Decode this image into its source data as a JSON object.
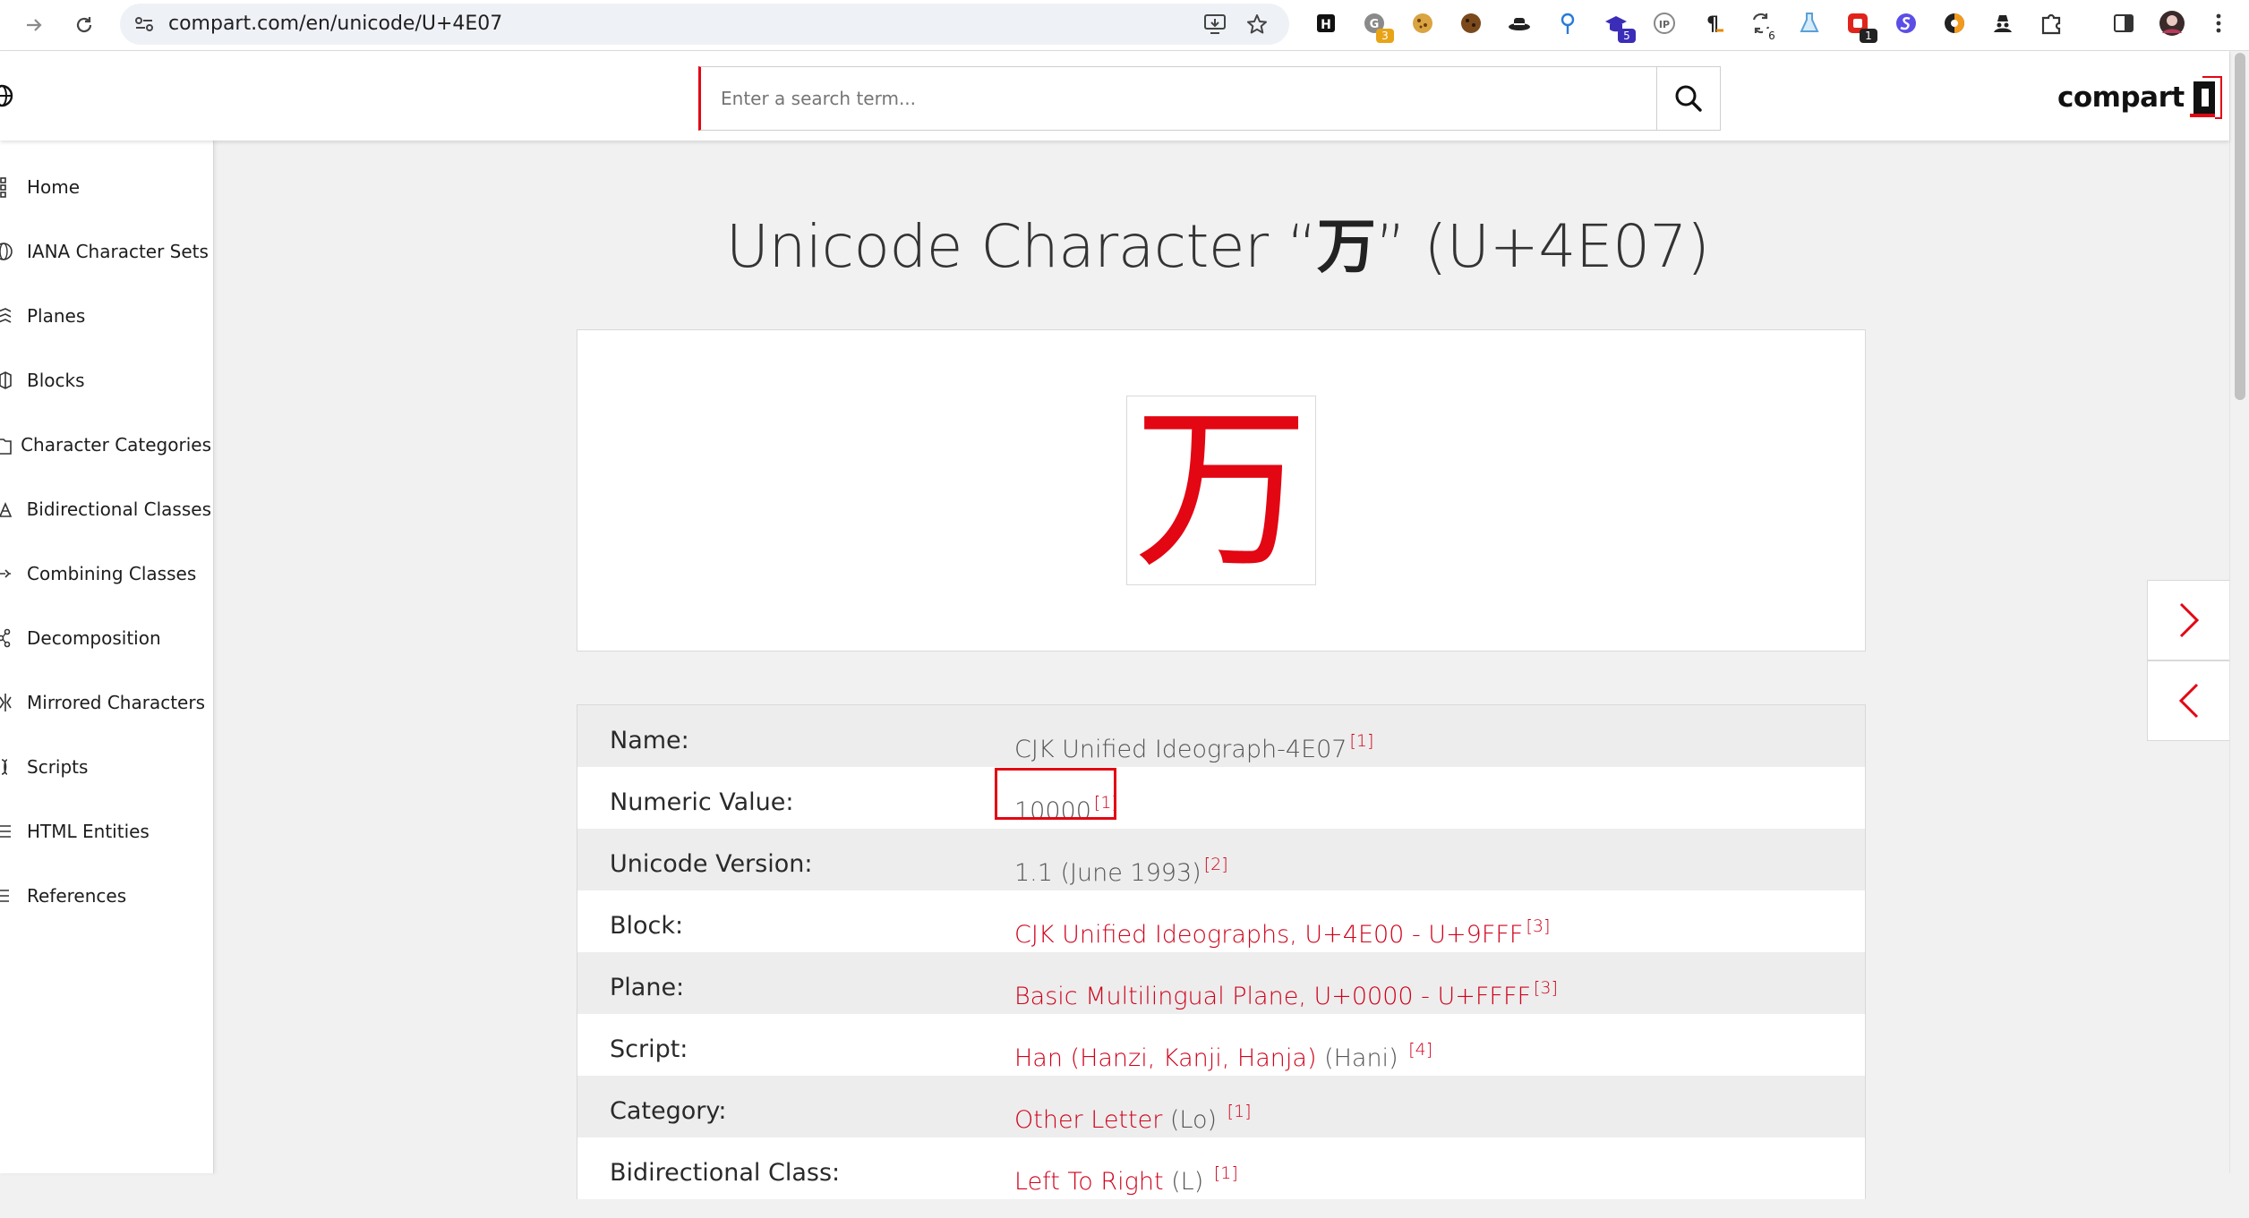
{
  "browser": {
    "url": "compart.com/en/unicode/U+4E07",
    "extensions": [
      {
        "name": "h-ext-icon",
        "badge": ""
      },
      {
        "name": "grammar-ext-icon",
        "badge": "3"
      },
      {
        "name": "cookie-ext-icon",
        "badge": ""
      },
      {
        "name": "cookie-dark-ext-icon",
        "badge": ""
      },
      {
        "name": "hat-ext-icon",
        "badge": ""
      },
      {
        "name": "pin-ext-icon",
        "badge": ""
      },
      {
        "name": "cap-ext-icon",
        "badge": "5"
      },
      {
        "name": "ip-ext-icon",
        "badge": ""
      },
      {
        "name": "pilcrow-ext-icon",
        "badge": ""
      },
      {
        "name": "sync-ext-icon",
        "badge": "6"
      },
      {
        "name": "flask-ext-icon",
        "badge": ""
      },
      {
        "name": "red-ext-icon",
        "badge": "1"
      },
      {
        "name": "s-purple-ext-icon",
        "badge": ""
      },
      {
        "name": "s-orange-ext-icon",
        "badge": ""
      },
      {
        "name": "spy-ext-icon",
        "badge": ""
      },
      {
        "name": "puzzle-icon",
        "badge": ""
      }
    ]
  },
  "header": {
    "search_placeholder": "Enter a search term...",
    "logo_text": "compart"
  },
  "sidebar": {
    "items": [
      {
        "label": "Home",
        "icon": "grid-icon"
      },
      {
        "label": "IANA Character Sets",
        "icon": "globe-icon"
      },
      {
        "label": "Planes",
        "icon": "layers-icon"
      },
      {
        "label": "Blocks",
        "icon": "cube-icon"
      },
      {
        "label": "Character Categories",
        "icon": "folder-icon"
      },
      {
        "label": "Bidirectional Classes",
        "icon": "triangle-icon"
      },
      {
        "label": "Combining Classes",
        "icon": "combine-icon"
      },
      {
        "label": "Decomposition",
        "icon": "share-icon"
      },
      {
        "label": "Mirrored Characters",
        "icon": "mirror-icon"
      },
      {
        "label": "Scripts",
        "icon": "script-icon"
      },
      {
        "label": "HTML Entities",
        "icon": "list-icon"
      },
      {
        "label": "References",
        "icon": "lines-icon"
      }
    ]
  },
  "main": {
    "title_prefix": "Unicode Character “",
    "title_glyph": "万",
    "title_suffix": "” (U+4E07)",
    "glyph": "万",
    "properties": [
      {
        "label": "Name:",
        "value": "CJK Unified Ideograph-4E07",
        "value_is_link": false,
        "extra": "",
        "ref": "[1]"
      },
      {
        "label": "Numeric Value:",
        "value": "10000",
        "value_is_link": false,
        "extra": "",
        "ref": "[1]"
      },
      {
        "label": "Unicode Version:",
        "value": "1.1 (June 1993)",
        "value_is_link": false,
        "extra": "",
        "ref": "[2]"
      },
      {
        "label": "Block:",
        "value": "CJK Unified Ideographs, U+4E00 - U+9FFF",
        "value_is_link": true,
        "extra": "",
        "ref": "[3]"
      },
      {
        "label": "Plane:",
        "value": "Basic Multilingual Plane, U+0000 - U+FFFF",
        "value_is_link": true,
        "extra": "",
        "ref": "[3]"
      },
      {
        "label": "Script:",
        "value": "Han (Hanzi, Kanji, Hanja)",
        "value_is_link": true,
        "extra": " (Hani) ",
        "ref": "[4]"
      },
      {
        "label": "Category:",
        "value": "Other Letter",
        "value_is_link": true,
        "extra": " (Lo) ",
        "ref": "[1]"
      },
      {
        "label": "Bidirectional Class:",
        "value": "Left To Right",
        "value_is_link": true,
        "extra": " (L) ",
        "ref": "[1]"
      }
    ]
  },
  "colors": {
    "accent": "#e30613",
    "link": "#d0021b",
    "row_shade": "#ededed"
  }
}
